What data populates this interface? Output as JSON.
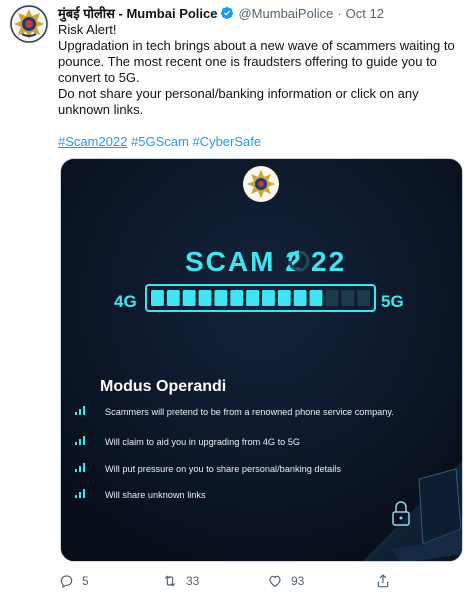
{
  "tweet": {
    "author_name": "मुंबई पोलीस - Mumbai Police",
    "handle": "@MumbaiPolice",
    "separator": "·",
    "date": "Oct 12",
    "text_lines": [
      "Risk Alert!",
      "Upgradation in tech brings about a new wave of scammers waiting to pounce. The most recent one is fraudsters offering to guide you to convert to 5G.",
      "Do not share your personal/banking information or click on any unknown links."
    ],
    "hashtags": [
      "#Scam2022",
      "#5GScam",
      "#CyberSafe"
    ]
  },
  "image": {
    "title_prefix": "SCAM 2",
    "title_suffix": "22",
    "left_label": "4G",
    "right_label": "5G",
    "progress_filled_segments": 11,
    "progress_total_segments": 14,
    "heading": "Modus Operandi",
    "bullets": [
      "Scammers will pretend to be from a renowned phone service company.",
      "Will claim to aid you in upgrading from 4G to 5G",
      "Will put pressure on you to share personal/banking details",
      "Will share unknown links"
    ]
  },
  "actions": {
    "replies": "5",
    "retweets": "33",
    "likes": "93"
  },
  "colors": {
    "link": "#1d9bf0",
    "image_bg": "#0a1322",
    "neon": "#3fe6f2",
    "text_secondary": "#536471"
  }
}
